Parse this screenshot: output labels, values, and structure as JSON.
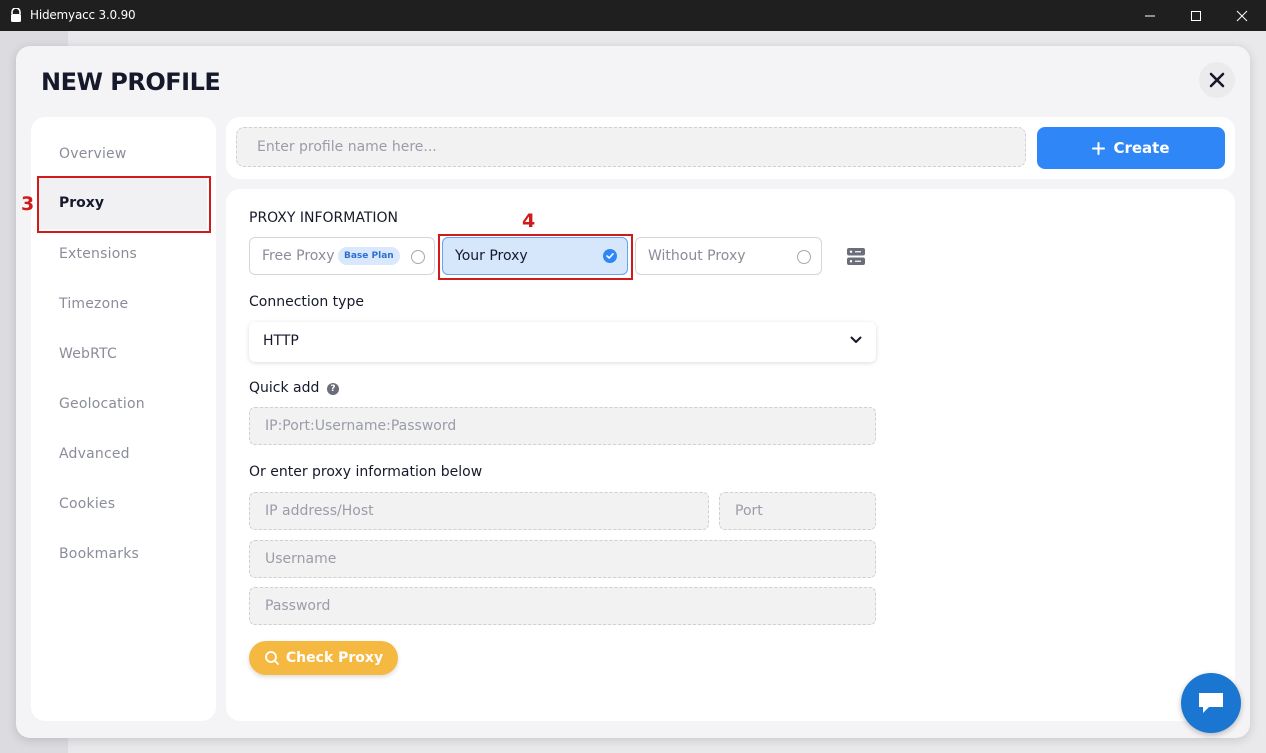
{
  "window": {
    "title": "Hidemyacc 3.0.90",
    "icons": [
      "app-icon",
      "minimize-icon",
      "maximize-icon",
      "close-icon"
    ]
  },
  "page": {
    "title": "NEW PROFILE",
    "close_icon": "close-icon"
  },
  "sidebar": {
    "items": [
      {
        "label": "Overview"
      },
      {
        "label": "Proxy",
        "active": true
      },
      {
        "label": "Extensions"
      },
      {
        "label": "Timezone"
      },
      {
        "label": "WebRTC"
      },
      {
        "label": "Geolocation"
      },
      {
        "label": "Advanced"
      },
      {
        "label": "Cookies"
      },
      {
        "label": "Bookmarks"
      }
    ]
  },
  "annotations": {
    "proxy_step": "3",
    "your_proxy_step": "4",
    "color": "#d11b1b"
  },
  "topbar": {
    "name_placeholder": "Enter profile name here...",
    "name_value": "",
    "create_label": "Create",
    "create_icon": "plus-icon"
  },
  "proxy": {
    "section_title": "PROXY INFORMATION",
    "options": {
      "free": {
        "label": "Free Proxy",
        "badge": "Base Plan",
        "selected": false
      },
      "yours": {
        "label": "Your Proxy",
        "selected": true
      },
      "none": {
        "label": "Without Proxy",
        "selected": false
      }
    },
    "server_icon": "server-icon",
    "connection_type_label": "Connection type",
    "connection_type_value": "HTTP",
    "quick_add_label": "Quick add",
    "quick_add_help": "?",
    "quick_add_placeholder": "IP:Port:Username:Password",
    "manual_label": "Or enter proxy information below",
    "host_placeholder": "IP address/Host",
    "port_placeholder": "Port",
    "username_placeholder": "Username",
    "password_placeholder": "Password",
    "check_label": "Check Proxy",
    "check_icon": "search-icon"
  },
  "colors": {
    "accent": "#2f86f6",
    "check_button": "#f5b942",
    "chat": "#1b76d2"
  },
  "chat_icon": "chat-icon"
}
